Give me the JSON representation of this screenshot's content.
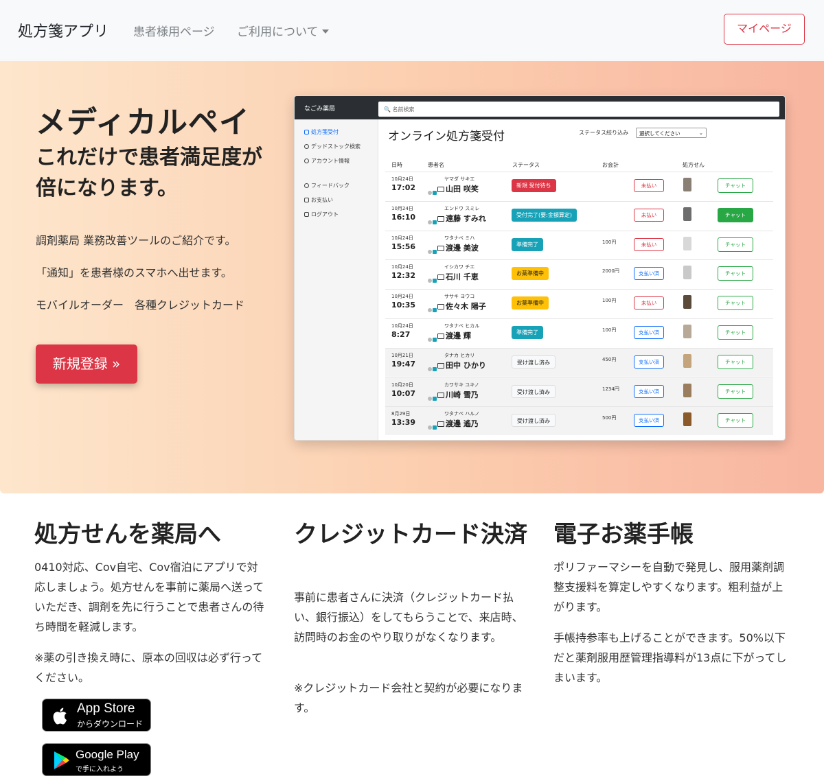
{
  "navbar": {
    "brand": "処方箋アプリ",
    "links": [
      "患者様用ページ",
      "ご利用について"
    ],
    "mypage": "マイページ"
  },
  "hero": {
    "title": "メディカルペイ",
    "subtitle": "これだけで患者満足度が倍になります。",
    "lines": [
      "調剤薬局 業務改善ツールのご紹介です。",
      "「通知」を患者様のスマホへ出せます。",
      "モバイルオーダー　各種クレジットカード"
    ],
    "signup": "新規登録 »"
  },
  "mock": {
    "brand": "なごみ薬局",
    "search_placeholder": "名前検索",
    "sidebar": [
      "処方箋受付",
      "デッドストック検索",
      "アカウント情報",
      "フィードバック",
      "お支払い",
      "ログアウト"
    ],
    "heading": "オンライン処方箋受付",
    "filter_label": "ステータス絞り込み",
    "filter_value": "選択してください",
    "headers": [
      "日時",
      "患者名",
      "ステータス",
      "お会計",
      "処方せん"
    ],
    "rows": [
      {
        "date": "10月24日",
        "time": "17:02",
        "kana": "ヤマダ サキエ",
        "name": "山田 咲笑",
        "status": "新規 受付待ち",
        "status_color": "#dc3545",
        "bill": "",
        "pay": "未払い",
        "pay_color": "#dc3545",
        "chat": "チャット",
        "chat_solid": false,
        "grey": false
      },
      {
        "date": "10月24日",
        "time": "16:10",
        "kana": "エンドウ スミレ",
        "name": "遠藤 すみれ",
        "status": "受付完了(要:金額算定)",
        "status_color": "#17a2b8",
        "bill": "",
        "pay": "未払い",
        "pay_color": "#dc3545",
        "chat": "チャット",
        "chat_solid": true,
        "grey": false
      },
      {
        "date": "10月24日",
        "time": "15:56",
        "kana": "ワタナベ ミハ",
        "name": "渡邊 美波",
        "status": "準備完了",
        "status_color": "#17a2b8",
        "bill": "100円",
        "pay": "未払い",
        "pay_color": "#dc3545",
        "chat": "チャット",
        "chat_solid": false,
        "grey": false
      },
      {
        "date": "10月24日",
        "time": "12:32",
        "kana": "イシカワ チエ",
        "name": "石川 千恵",
        "status": "お薬準備中",
        "status_color": "#ffc107",
        "bill": "2000円",
        "pay": "支払い済",
        "pay_color": "#0d6efd",
        "chat": "チャット",
        "chat_solid": false,
        "grey": false
      },
      {
        "date": "10月24日",
        "time": "10:35",
        "kana": "ササキ ヨウコ",
        "name": "佐々木 陽子",
        "status": "お薬準備中",
        "status_color": "#ffc107",
        "bill": "100円",
        "pay": "未払い",
        "pay_color": "#dc3545",
        "chat": "チャット",
        "chat_solid": false,
        "grey": false
      },
      {
        "date": "10月24日",
        "time": "8:27",
        "kana": "ワタナベ ヒカル",
        "name": "渡邊 輝",
        "status": "準備完了",
        "status_color": "#17a2b8",
        "bill": "100円",
        "pay": "支払い済",
        "pay_color": "#0d6efd",
        "chat": "チャット",
        "chat_solid": false,
        "grey": false
      },
      {
        "date": "10月21日",
        "time": "19:47",
        "kana": "タナカ ヒカリ",
        "name": "田中 ひかり",
        "status": "受け渡し済み",
        "status_color": "#f8f9fa",
        "bill": "450円",
        "pay": "支払い済",
        "pay_color": "#0d6efd",
        "chat": "チャット",
        "chat_solid": false,
        "grey": true
      },
      {
        "date": "10月20日",
        "time": "10:07",
        "kana": "カワサキ ユキノ",
        "name": "川崎 雪乃",
        "status": "受け渡し済み",
        "status_color": "#f8f9fa",
        "bill": "1234円",
        "pay": "支払い済",
        "pay_color": "#0d6efd",
        "chat": "チャット",
        "chat_solid": false,
        "grey": true
      },
      {
        "date": "8月29日",
        "time": "13:39",
        "kana": "ワタナベ ハルノ",
        "name": "渡邊 遙乃",
        "status": "受け渡し済み",
        "status_color": "#f8f9fa",
        "bill": "500円",
        "pay": "支払い済",
        "pay_color": "#0d6efd",
        "chat": "チャット",
        "chat_solid": false,
        "grey": true
      }
    ]
  },
  "features": [
    {
      "title": "処方せんを薬局へ",
      "paragraphs": [
        "0410対応、Cov自宅、Cov宿泊にアプリで対応しましょう。処方せんを事前に薬局へ送っていただき、調剤を先に行うことで患者さんの待ち時間を軽減します。",
        "※薬の引き換え時に、原本の回収は必ず行ってください。"
      ]
    },
    {
      "title": "クレジットカード決済",
      "paragraphs": [
        "事前に患者さんに決済（クレジットカード払い、銀行振込）をしてもらうことで、来店時、訪問時のお金のやり取りがなくなります。",
        "※クレジットカード会社と契約が必要になります。"
      ]
    },
    {
      "title": "電子お薬手帳",
      "paragraphs": [
        "ポリファーマシーを自動で発見し、服用薬剤調整支援料を算定しやすくなります。粗利益が上がります。",
        "手帳持参率も上げることができます。50%以下だと薬剤服用歴管理指導料が13点に下がってしまいます。"
      ]
    }
  ],
  "badges": {
    "appstore_big": "App Store",
    "appstore_small": "からダウンロード",
    "gplay_big": "Google Play",
    "gplay_small": "で手に入れよう"
  },
  "colors": {
    "danger": "#dc3545",
    "success": "#28a745",
    "info": "#17a2b8",
    "warning": "#ffc107",
    "primary": "#0d6efd"
  }
}
